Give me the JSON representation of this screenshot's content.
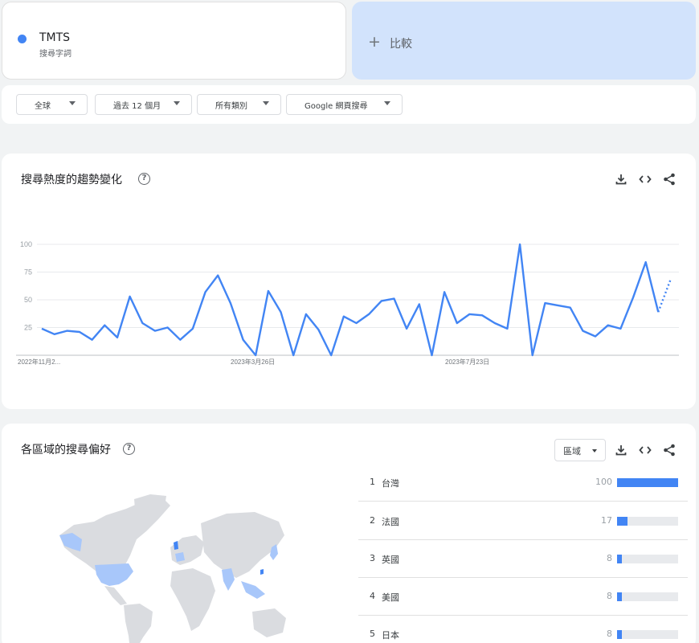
{
  "search_term": {
    "name": "TMTS",
    "subtitle": "搜尋字詞",
    "color": "#4285f4"
  },
  "compare": {
    "label": "比較"
  },
  "filters": [
    {
      "label": "全球"
    },
    {
      "label": "過去 12 個月"
    },
    {
      "label": "所有類別"
    },
    {
      "label": "Google 網頁搜尋"
    }
  ],
  "trend": {
    "title": "搜尋熱度的趨勢變化",
    "help": "?"
  },
  "chart_data": {
    "type": "line",
    "x_tick_labels": [
      "2022年11月2...",
      "2023年3月26日",
      "2023年7月23日"
    ],
    "y_ticks": [
      100,
      75,
      50,
      25
    ],
    "ylim": [
      0,
      100
    ],
    "series": [
      {
        "values": [
          24,
          19,
          22,
          21,
          14,
          27,
          16,
          53,
          29,
          22,
          25,
          14,
          24,
          57,
          72,
          47,
          14,
          0,
          58,
          39,
          0,
          37,
          23,
          0,
          35,
          29,
          37,
          49,
          51,
          24,
          46,
          0,
          57,
          29,
          37,
          36,
          29,
          24,
          100,
          0,
          47,
          45,
          43,
          22,
          17,
          27,
          24,
          52,
          84,
          39
        ],
        "partial_values": [
          39,
          69
        ],
        "color": "#4285f4"
      }
    ]
  },
  "regions": {
    "title": "各區域的搜尋偏好",
    "help": "?",
    "select_label": "區域",
    "rows": [
      {
        "rank": "1",
        "name": "台灣",
        "value": 100
      },
      {
        "rank": "2",
        "name": "法國",
        "value": 17
      },
      {
        "rank": "3",
        "name": "英國",
        "value": 8
      },
      {
        "rank": "4",
        "name": "美國",
        "value": 8
      },
      {
        "rank": "5",
        "name": "日本",
        "value": 8
      }
    ]
  },
  "icons": {
    "download": "download-icon",
    "embed": "embed-code-icon",
    "share": "share-icon",
    "plus": "plus-icon",
    "help": "help-circle-icon"
  }
}
